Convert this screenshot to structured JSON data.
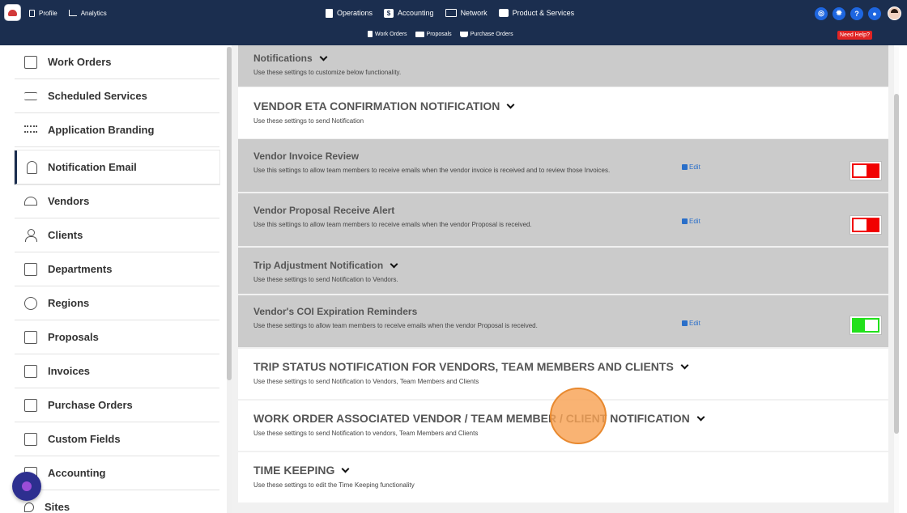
{
  "topnav": {
    "left": [
      {
        "label": "Profile",
        "icon": "document-icon"
      },
      {
        "label": "Analytics",
        "icon": "chart-icon"
      }
    ],
    "center": [
      {
        "label": "Operations",
        "icon": "clipboard-icon"
      },
      {
        "label": "Accounting",
        "icon": "dollar-icon"
      },
      {
        "label": "Network",
        "icon": "network-icon"
      },
      {
        "label": "Product & Services",
        "icon": "briefcase-icon"
      }
    ],
    "right_icons": [
      "target-icon",
      "gear-icon",
      "help-icon",
      "chat-icon",
      "avatar"
    ],
    "help_glyph": "?"
  },
  "subnav": {
    "items": [
      {
        "label": "Work Orders",
        "icon": "clipboard-icon"
      },
      {
        "label": "Proposals",
        "icon": "proposal-icon"
      },
      {
        "label": "Purchase Orders",
        "icon": "cart-icon"
      }
    ],
    "help_button": "Need Help?"
  },
  "sidebar": {
    "items": [
      {
        "label": "Work Orders",
        "icon": "clipboard-icon"
      },
      {
        "label": "Scheduled Services",
        "icon": "handshake-icon"
      },
      {
        "label": "Application Branding",
        "icon": "group-icon"
      },
      {
        "label": "Notification Email",
        "icon": "bell-icon",
        "active": true
      },
      {
        "label": "Vendors",
        "icon": "hardhat-icon"
      },
      {
        "label": "Clients",
        "icon": "person-icon"
      },
      {
        "label": "Departments",
        "icon": "building-icon"
      },
      {
        "label": "Regions",
        "icon": "globe-icon"
      },
      {
        "label": "Proposals",
        "icon": "proposal-icon"
      },
      {
        "label": "Invoices",
        "icon": "invoice-icon"
      },
      {
        "label": "Purchase Orders",
        "icon": "purchase-order-icon"
      },
      {
        "label": "Custom Fields",
        "icon": "custom-fields-icon"
      },
      {
        "label": "Accounting",
        "icon": "accounting-icon"
      },
      {
        "label": "Sites",
        "icon": "pin-icon"
      }
    ]
  },
  "main": {
    "sections": [
      {
        "title": "Notifications",
        "desc": "Use these settings to customize below functionality."
      },
      {
        "title": "VENDOR ETA CONFIRMATION NOTIFICATION",
        "desc": "Use these settings to send Notification"
      },
      {
        "title": "Vendor Invoice Review",
        "desc": "Use this settings to allow team members to receive emails when the vendor invoice is received and to review those Invoices.",
        "edit": "Edit",
        "toggle": "off"
      },
      {
        "title": "Vendor Proposal Receive Alert",
        "desc": "Use this settings to allow team members to receive emails when the vendor Proposal is received.",
        "edit": "Edit",
        "toggle": "off"
      },
      {
        "title": "Trip Adjustment Notification",
        "desc": "Use these settings to send Notification to Vendors."
      },
      {
        "title": "Vendor's COI Expiration Reminders",
        "desc": "Use these settings to allow team members to receive emails when the vendor Proposal is received.",
        "edit": "Edit",
        "toggle": "on"
      },
      {
        "title": "TRIP STATUS NOTIFICATION FOR VENDORS, TEAM MEMBERS AND CLIENTS",
        "desc": "Use these settings to send Notification to Vendors, Team Members and Clients"
      },
      {
        "title": "WORK ORDER ASSOCIATED VENDOR / TEAM MEMBER / CLIENT NOTIFICATION",
        "desc": "Use these settings to send Notification to vendors, Team Members and Clients"
      },
      {
        "title": "TIME KEEPING",
        "desc": "Use these settings to edit the Time Keeping functionality"
      }
    ]
  },
  "colors": {
    "navbar": "#1b2e4f",
    "toggle_off": "#f10000",
    "toggle_on": "#22e01b",
    "edit_link": "#2a6fc9",
    "help_button": "#e02424",
    "click_highlight": "#f8a254"
  }
}
